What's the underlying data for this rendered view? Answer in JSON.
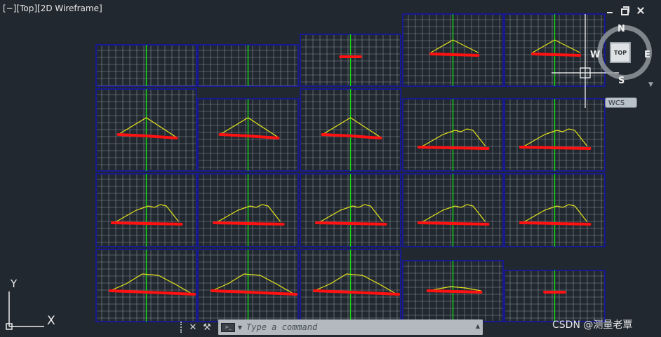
{
  "viewport": {
    "label": "[−][Top][2D Wireframe]"
  },
  "window_controls": [
    "minimize-icon",
    "restore-icon",
    "close-icon"
  ],
  "navigation": {
    "directions": {
      "north": "N",
      "south": "S",
      "east": "E",
      "west": "W"
    },
    "cube_face": "TOP",
    "coordinate_system": "WCS"
  },
  "ucs": {
    "x": "X",
    "y": "Y"
  },
  "command_line": {
    "placeholder": "Type a command"
  },
  "watermark": "CSDN @测量老覃",
  "colors": {
    "background": "#212830",
    "frame": "#1616a8",
    "grid": "#a7aeb6",
    "centerline": "#14d814",
    "profile": "#e6e619",
    "markup": "#ff1212"
  },
  "sections": [
    {
      "row": 1,
      "col": 1,
      "profile": "empty"
    },
    {
      "row": 1,
      "col": 2,
      "profile": "empty"
    },
    {
      "row": 1,
      "col": 3,
      "profile": "flat-small"
    },
    {
      "row": 1,
      "col": 4,
      "profile": "small-mound"
    },
    {
      "row": 1,
      "col": 5,
      "profile": "small-mound"
    },
    {
      "row": 2,
      "col": 1,
      "profile": "mound"
    },
    {
      "row": 2,
      "col": 2,
      "profile": "mound"
    },
    {
      "row": 2,
      "col": 3,
      "profile": "mound"
    },
    {
      "row": 2,
      "col": 4,
      "profile": "mound-ridged"
    },
    {
      "row": 2,
      "col": 5,
      "profile": "mound-ridged"
    },
    {
      "row": 3,
      "col": 1,
      "profile": "mound-ridged"
    },
    {
      "row": 3,
      "col": 2,
      "profile": "mound-ridged"
    },
    {
      "row": 3,
      "col": 3,
      "profile": "mound-ridged"
    },
    {
      "row": 3,
      "col": 4,
      "profile": "mound-ridged"
    },
    {
      "row": 3,
      "col": 5,
      "profile": "mound-ridged"
    },
    {
      "row": 4,
      "col": 1,
      "profile": "wide-mound"
    },
    {
      "row": 4,
      "col": 2,
      "profile": "wide-mound"
    },
    {
      "row": 4,
      "col": 3,
      "profile": "wide-mound"
    },
    {
      "row": 4,
      "col": 4,
      "profile": "flat-wide"
    },
    {
      "row": 4,
      "col": 5,
      "profile": "flat-small"
    }
  ]
}
